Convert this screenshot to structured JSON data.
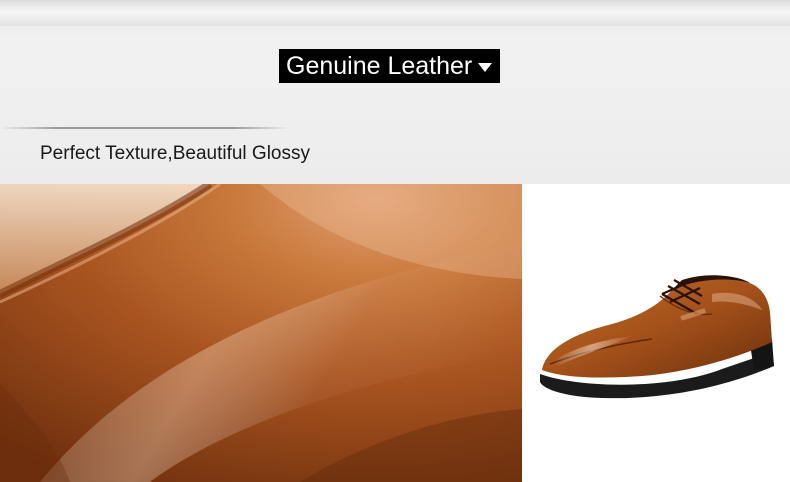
{
  "header": {
    "title": "Genuine Leather",
    "title_caret_icon": "caret-down-icon",
    "subtitle": "Perfect Texture,Beautiful Glossy"
  },
  "colors": {
    "title_bg": "#000000",
    "title_text": "#ffffff",
    "banner_bg": "#eeeeee",
    "leather_base": "#9c4a18",
    "leather_highlight": "#d79a6a"
  }
}
